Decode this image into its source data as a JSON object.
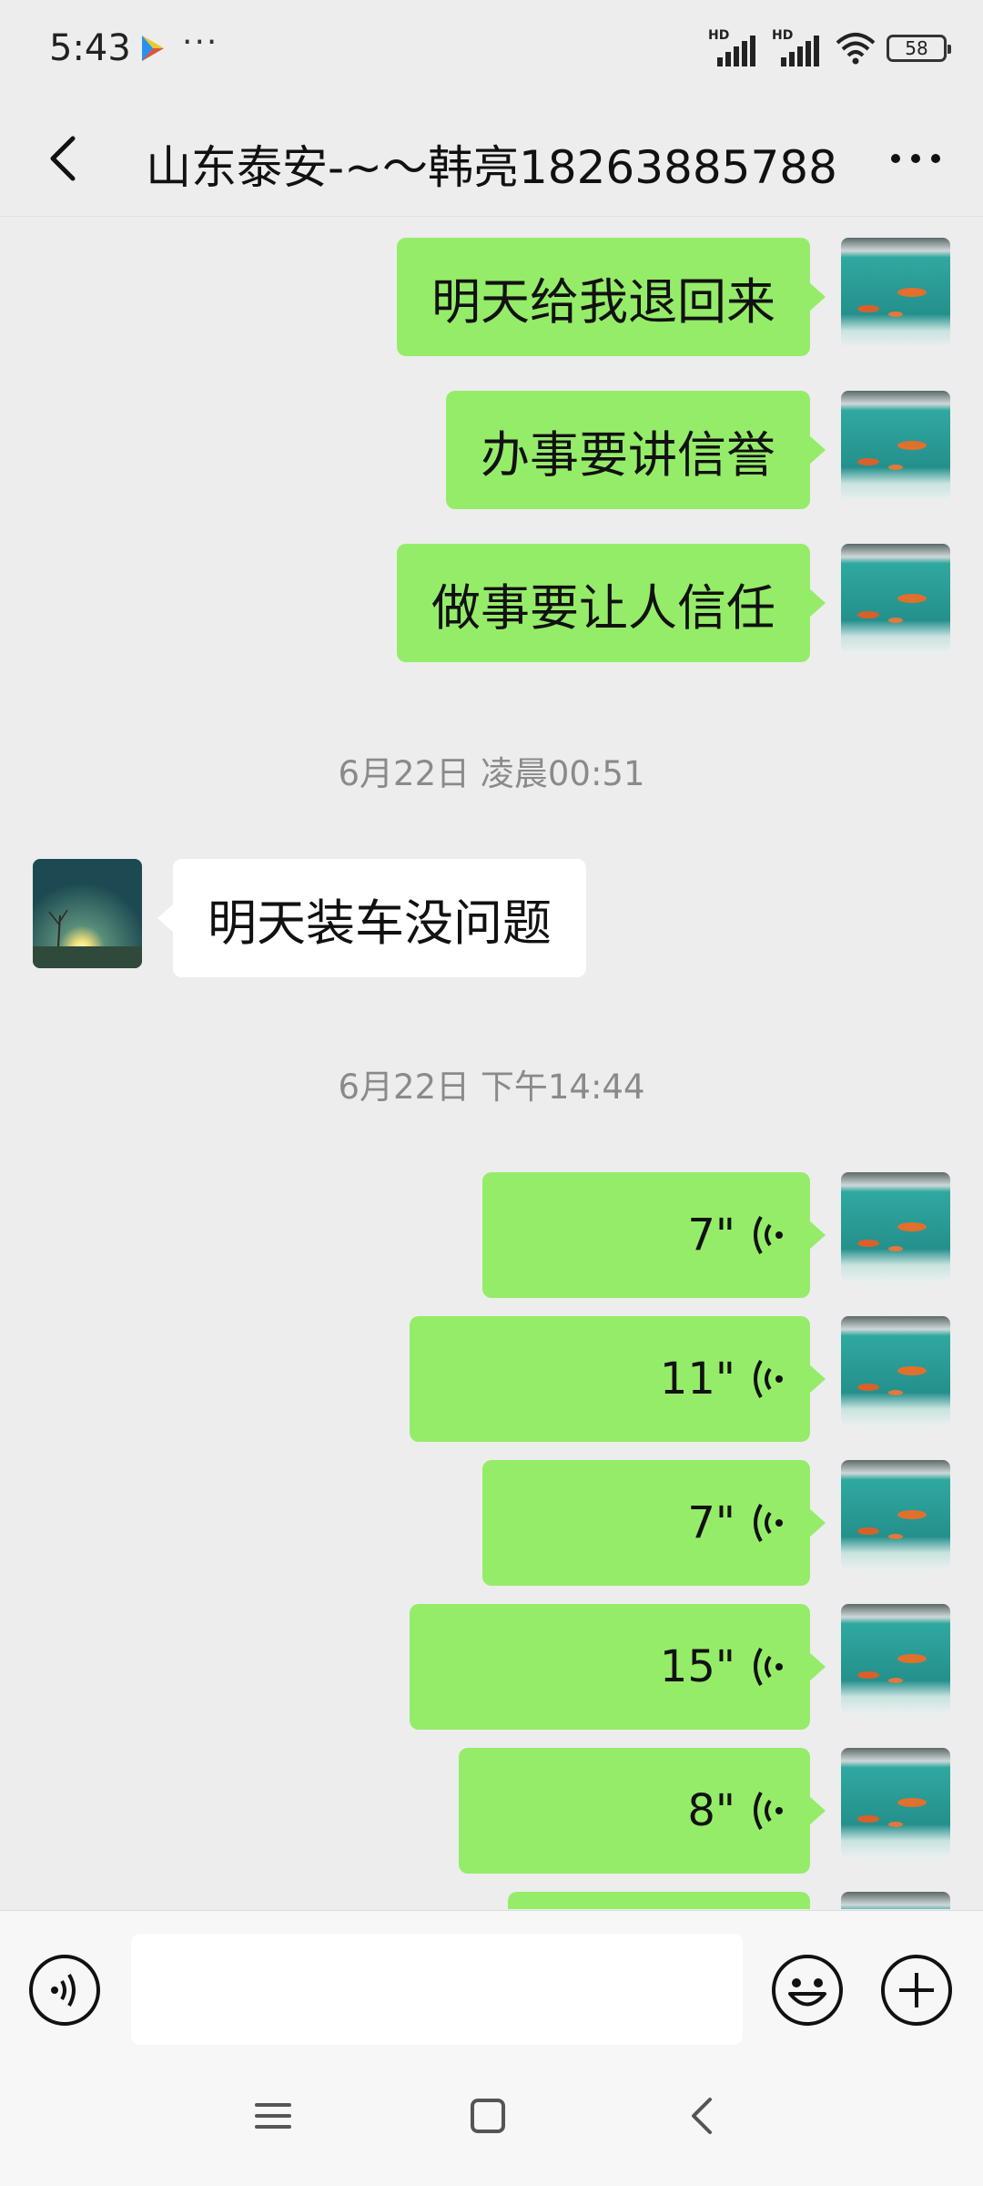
{
  "status_bar": {
    "time": "5:43",
    "more": "···",
    "signal_1_label": "HD",
    "signal_2_label": "HD",
    "battery": "58"
  },
  "header": {
    "title": "山东泰安-~～韩亮18263885788"
  },
  "messages": [
    {
      "type": "text",
      "from": "self",
      "text": "明天给我退回来"
    },
    {
      "type": "text",
      "from": "self",
      "text": "办事要讲信誉"
    },
    {
      "type": "text",
      "from": "self",
      "text": "做事要让人信任"
    },
    {
      "type": "timestamp",
      "text": "6月22日 凌晨00:51"
    },
    {
      "type": "text",
      "from": "other",
      "text": "明天装车没问题"
    },
    {
      "type": "timestamp",
      "text": "6月22日 下午14:44"
    },
    {
      "type": "voice",
      "from": "self",
      "duration": "7\""
    },
    {
      "type": "voice",
      "from": "self",
      "duration": "11\""
    },
    {
      "type": "voice",
      "from": "self",
      "duration": "7\""
    },
    {
      "type": "voice",
      "from": "self",
      "duration": "15\""
    },
    {
      "type": "voice",
      "from": "self",
      "duration": "8\""
    },
    {
      "type": "voice",
      "from": "self",
      "duration": ""
    }
  ],
  "input": {
    "value": "",
    "placeholder": ""
  },
  "colors": {
    "background": "#ededed",
    "outgoing_bubble": "#95ec69",
    "incoming_bubble": "#ffffff",
    "timestamp_text": "#8a8a8a"
  },
  "icons": {
    "back": "chevron-left-icon",
    "more": "more-horizontal-icon",
    "voice_toggle": "voice-mode-icon",
    "emoji": "emoji-smile-icon",
    "plus": "plus-circle-icon",
    "nav_menu": "menu-icon",
    "nav_home": "home-square-icon",
    "nav_back": "nav-back-icon"
  }
}
